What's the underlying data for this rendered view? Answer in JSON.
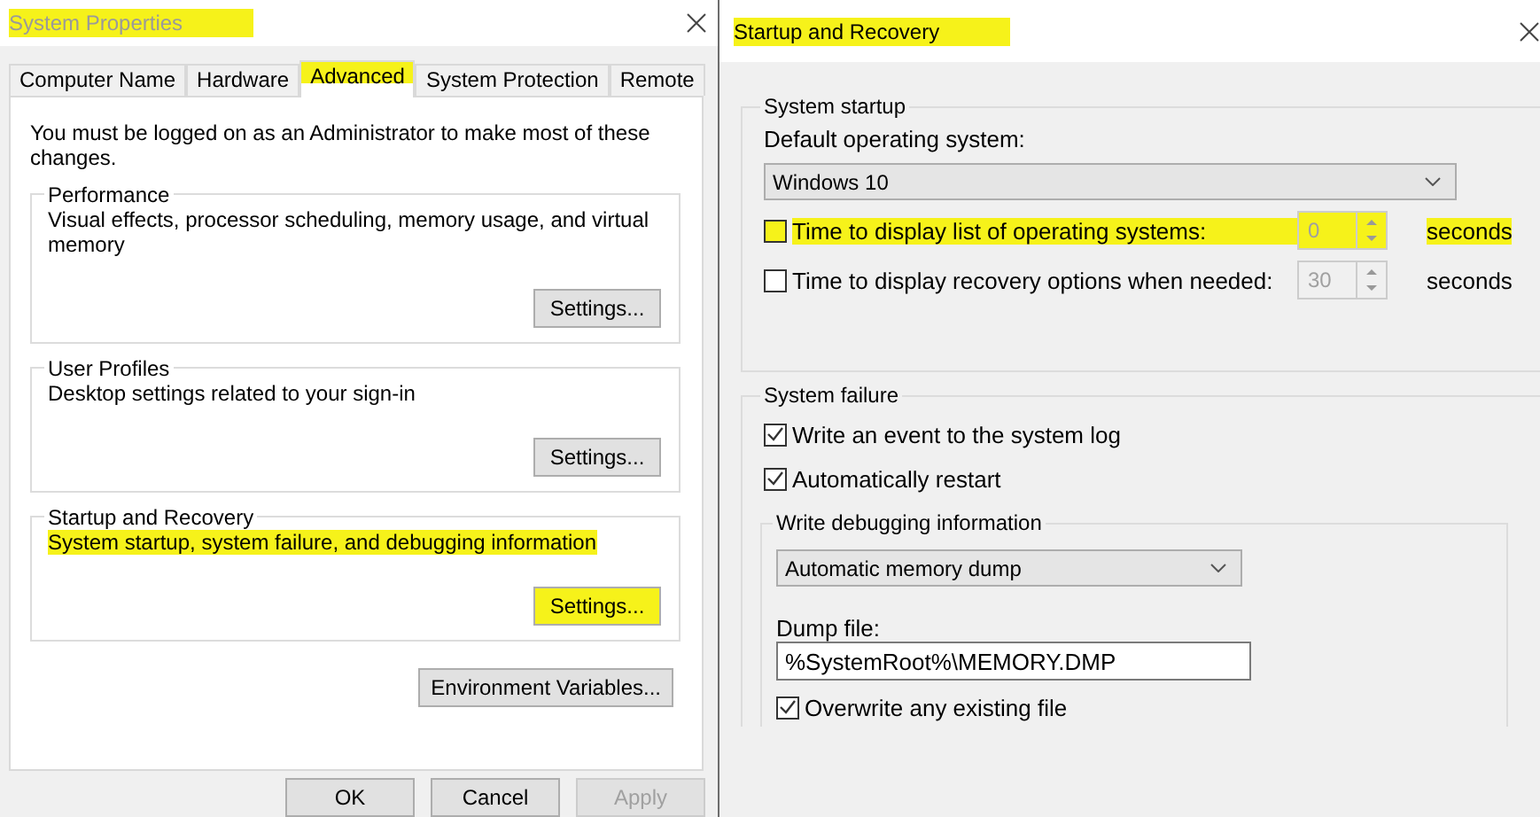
{
  "system_properties": {
    "title": "System Properties",
    "title_highlighted": true,
    "tabs": [
      {
        "label": "Computer Name",
        "selected": false,
        "highlighted": false
      },
      {
        "label": "Hardware",
        "selected": false,
        "highlighted": false
      },
      {
        "label": "Advanced",
        "selected": true,
        "highlighted": true
      },
      {
        "label": "System Protection",
        "selected": false,
        "highlighted": false
      },
      {
        "label": "Remote",
        "selected": false,
        "highlighted": false
      }
    ],
    "notice": "You must be logged on as an Administrator to make most of these changes.",
    "groups": [
      {
        "title": "Performance",
        "description": "Visual effects, processor scheduling, memory usage, and virtual memory",
        "description_highlighted": false,
        "button": "Settings...",
        "button_highlighted": false
      },
      {
        "title": "User Profiles",
        "description": "Desktop settings related to your sign-in",
        "description_highlighted": false,
        "button": "Settings...",
        "button_highlighted": false
      },
      {
        "title": "Startup and Recovery",
        "description": "System startup, system failure, and debugging information",
        "description_highlighted": true,
        "button": "Settings...",
        "button_highlighted": true
      }
    ],
    "env_button": "Environment Variables...",
    "buttons": [
      {
        "label": "OK",
        "disabled": false
      },
      {
        "label": "Cancel",
        "disabled": false
      },
      {
        "label": "Apply",
        "disabled": true
      }
    ]
  },
  "startup_recovery": {
    "title": "Startup and Recovery",
    "title_highlighted": true,
    "system_startup": {
      "title": "System startup",
      "default_os_label": "Default operating system:",
      "default_os": "Windows 10",
      "timers": [
        {
          "label": "Time to display list of operating systems:",
          "checked": false,
          "value": "0",
          "disabled": true,
          "unit": "seconds",
          "highlighted": true
        },
        {
          "label": "Time to display recovery options when needed:",
          "checked": false,
          "value": "30",
          "disabled": true,
          "unit": "seconds",
          "highlighted": false
        }
      ]
    },
    "system_failure": {
      "title": "System failure",
      "options": [
        {
          "label": "Write an event to the system log",
          "checked": true
        },
        {
          "label": "Automatically restart",
          "checked": true
        }
      ],
      "debugging": {
        "title": "Write debugging information",
        "dump_type": "Automatic memory dump",
        "dump_file_label": "Dump file:",
        "dump_file": "%SystemRoot%\\MEMORY.DMP",
        "overwrite": {
          "label": "Overwrite any existing file",
          "checked": true
        }
      }
    }
  }
}
